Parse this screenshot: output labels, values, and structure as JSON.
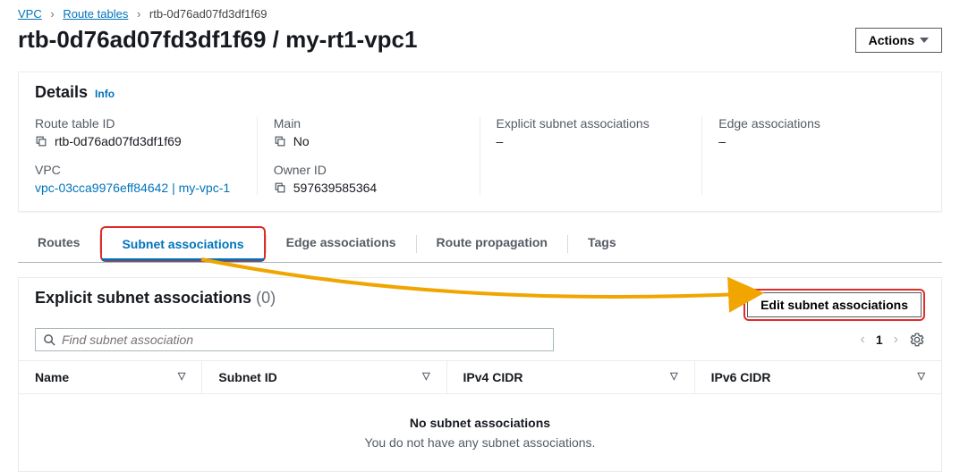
{
  "breadcrumb": {
    "root": "VPC",
    "mid": "Route tables",
    "current": "rtb-0d76ad07fd3df1f69"
  },
  "title": "rtb-0d76ad07fd3df1f69 / my-rt1-vpc1",
  "actions_label": "Actions",
  "details": {
    "heading": "Details",
    "info": "Info",
    "route_table_id": {
      "label": "Route table ID",
      "value": "rtb-0d76ad07fd3df1f69"
    },
    "main": {
      "label": "Main",
      "value": "No"
    },
    "explicit": {
      "label": "Explicit subnet associations",
      "value": "–"
    },
    "edge": {
      "label": "Edge associations",
      "value": "–"
    },
    "vpc": {
      "label": "VPC",
      "value": "vpc-03cca9976eff84642 | my-vpc-1"
    },
    "owner": {
      "label": "Owner ID",
      "value": "597639585364"
    }
  },
  "tabs": [
    "Routes",
    "Subnet associations",
    "Edge associations",
    "Route propagation",
    "Tags"
  ],
  "assoc": {
    "heading": "Explicit subnet associations",
    "count": "(0)",
    "edit_label": "Edit subnet associations",
    "search_placeholder": "Find subnet association",
    "page": "1",
    "columns": [
      "Name",
      "Subnet ID",
      "IPv4 CIDR",
      "IPv6 CIDR"
    ],
    "empty_title": "No subnet associations",
    "empty_sub": "You do not have any subnet associations."
  }
}
